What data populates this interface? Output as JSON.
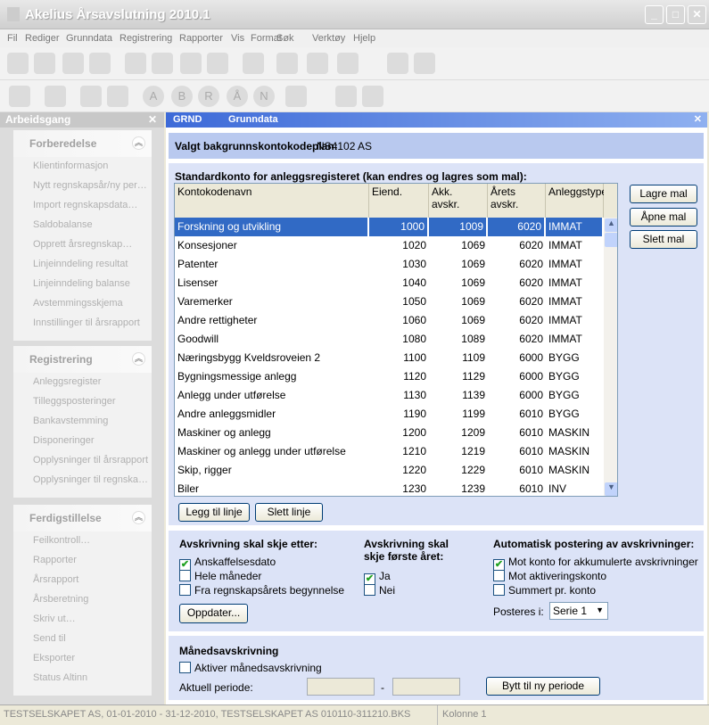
{
  "window": {
    "title": "Akelius Årsavslutning 2010.1"
  },
  "menu": [
    "Fil",
    "Rediger",
    "Grunndata",
    "Registrering",
    "Rapporter",
    "Vis",
    "Format",
    "Søk",
    "Verktøy",
    "Hjelp"
  ],
  "toolbar1": [
    "back-icon",
    "forward-icon",
    "export-icon",
    "import-icon",
    "cabinet-icon",
    "open-icon",
    "save-icon",
    "close-doc-icon",
    "check-icon",
    "stamp-icon",
    "scale-icon",
    "tree-icon",
    "user-icon",
    "sort-icon"
  ],
  "toolbar2": [
    "music-note-icon",
    "find-doc-icon",
    "print-icon",
    "preview-icon",
    "A",
    "B",
    "R",
    "Å",
    "N",
    "printer-dropdown-icon",
    "grid-import-icon",
    "grid-export-icon"
  ],
  "sidebar": {
    "title": "Arbeidsgang",
    "groups": [
      {
        "title": "Forberedelse",
        "items": [
          "Klientinformasjon",
          "Nytt regnskapsår/ny per…",
          "Import regnskapsdata…",
          "Saldobalanse",
          "Opprett årsregnskap…",
          "Linjeinndeling resultat",
          "Linjeinndeling balanse",
          "Avstemmingsskjema",
          "Innstillinger til årsrapport"
        ]
      },
      {
        "title": "Registrering",
        "items": [
          "Anleggsregister",
          "Tilleggsposteringer",
          "Bankavstemming",
          "Disponeringer",
          "Opplysninger til årsrapport",
          "Opplysninger til regnska…"
        ]
      },
      {
        "title": "Ferdigstillelse",
        "items": [
          "Feilkontroll…",
          "Rapporter",
          "Årsrapport",
          "Årsberetning",
          "Skriv ut…",
          "Send til",
          "Eksporter",
          "Status Altinn"
        ]
      }
    ]
  },
  "main": {
    "code": "GRND",
    "title": "Grunndata",
    "plan_label": "Valgt bakgrunnskontokodeplan:",
    "plan_value": "NS4102 AS",
    "grid_title": "Standardkonto for anleggsregisteret (kan endres og lagres som mal):",
    "columns": [
      "Kontokodenavn",
      "Eiend.",
      "Akk.\navskr.",
      "Årets\navskr.",
      "Anleggstype"
    ],
    "rows": [
      [
        "Forskning og utvikling",
        "1000",
        "1009",
        "6020",
        "IMMAT"
      ],
      [
        "Konsesjoner",
        "1020",
        "1069",
        "6020",
        "IMMAT"
      ],
      [
        "Patenter",
        "1030",
        "1069",
        "6020",
        "IMMAT"
      ],
      [
        "Lisenser",
        "1040",
        "1069",
        "6020",
        "IMMAT"
      ],
      [
        "Varemerker",
        "1050",
        "1069",
        "6020",
        "IMMAT"
      ],
      [
        "Andre rettigheter",
        "1060",
        "1069",
        "6020",
        "IMMAT"
      ],
      [
        "Goodwill",
        "1080",
        "1089",
        "6020",
        "IMMAT"
      ],
      [
        "Næringsbygg Kveldsroveien 2",
        "1100",
        "1109",
        "6000",
        "BYGG"
      ],
      [
        "Bygningsmessige anlegg",
        "1120",
        "1129",
        "6000",
        "BYGG"
      ],
      [
        "Anlegg under utførelse",
        "1130",
        "1139",
        "6000",
        "BYGG"
      ],
      [
        "Andre anleggsmidler",
        "1190",
        "1199",
        "6010",
        "BYGG"
      ],
      [
        "Maskiner og anlegg",
        "1200",
        "1209",
        "6010",
        "MASKIN"
      ],
      [
        "Maskiner og anlegg under utførelse",
        "1210",
        "1219",
        "6010",
        "MASKIN"
      ],
      [
        "Skip, rigger",
        "1220",
        "1229",
        "6010",
        "MASKIN"
      ],
      [
        "Biler",
        "1230",
        "1239",
        "6010",
        "INV"
      ]
    ],
    "selected_row": 0,
    "buttons": {
      "save_template": "Lagre mal",
      "open_template": "Åpne mal",
      "delete_template": "Slett mal",
      "add_line": "Legg til linje",
      "delete_line": "Slett linje",
      "update": "Oppdater...",
      "next_period": "Bytt til ny periode"
    },
    "depr_after": {
      "title": "Avskrivning skal skje etter:",
      "options": [
        {
          "label": "Anskaffelsesdato",
          "checked": true
        },
        {
          "label": "Hele måneder",
          "checked": false
        },
        {
          "label": "Fra regnskapsårets begynnelse",
          "checked": false
        }
      ]
    },
    "first_year": {
      "title": "Avskrivning skal skje første året:",
      "options": [
        {
          "label": "Ja",
          "checked": true
        },
        {
          "label": "Nei",
          "checked": false
        }
      ]
    },
    "auto_post": {
      "title": "Automatisk postering av avskrivninger:",
      "options": [
        {
          "label": "Mot konto for akkumulerte avskrivninger",
          "checked": true
        },
        {
          "label": "Mot aktiveringskonto",
          "checked": false
        },
        {
          "label": "Summert pr. konto",
          "checked": false
        }
      ],
      "post_label": "Posteres i:",
      "post_value": "Serie 1"
    },
    "monthly": {
      "title": "Månedsavskrivning",
      "activate": "Aktiver månedsavskrivning",
      "activate_checked": false,
      "period_label": "Aktuell periode:",
      "period_from": "",
      "period_to": "",
      "dash": "-"
    }
  },
  "status": {
    "left": "TESTSELSKAPET AS, 01-01-2010 - 31-12-2010, TESTSELSKAPET AS 010110-311210.BKS",
    "right": "Kolonne 1"
  }
}
